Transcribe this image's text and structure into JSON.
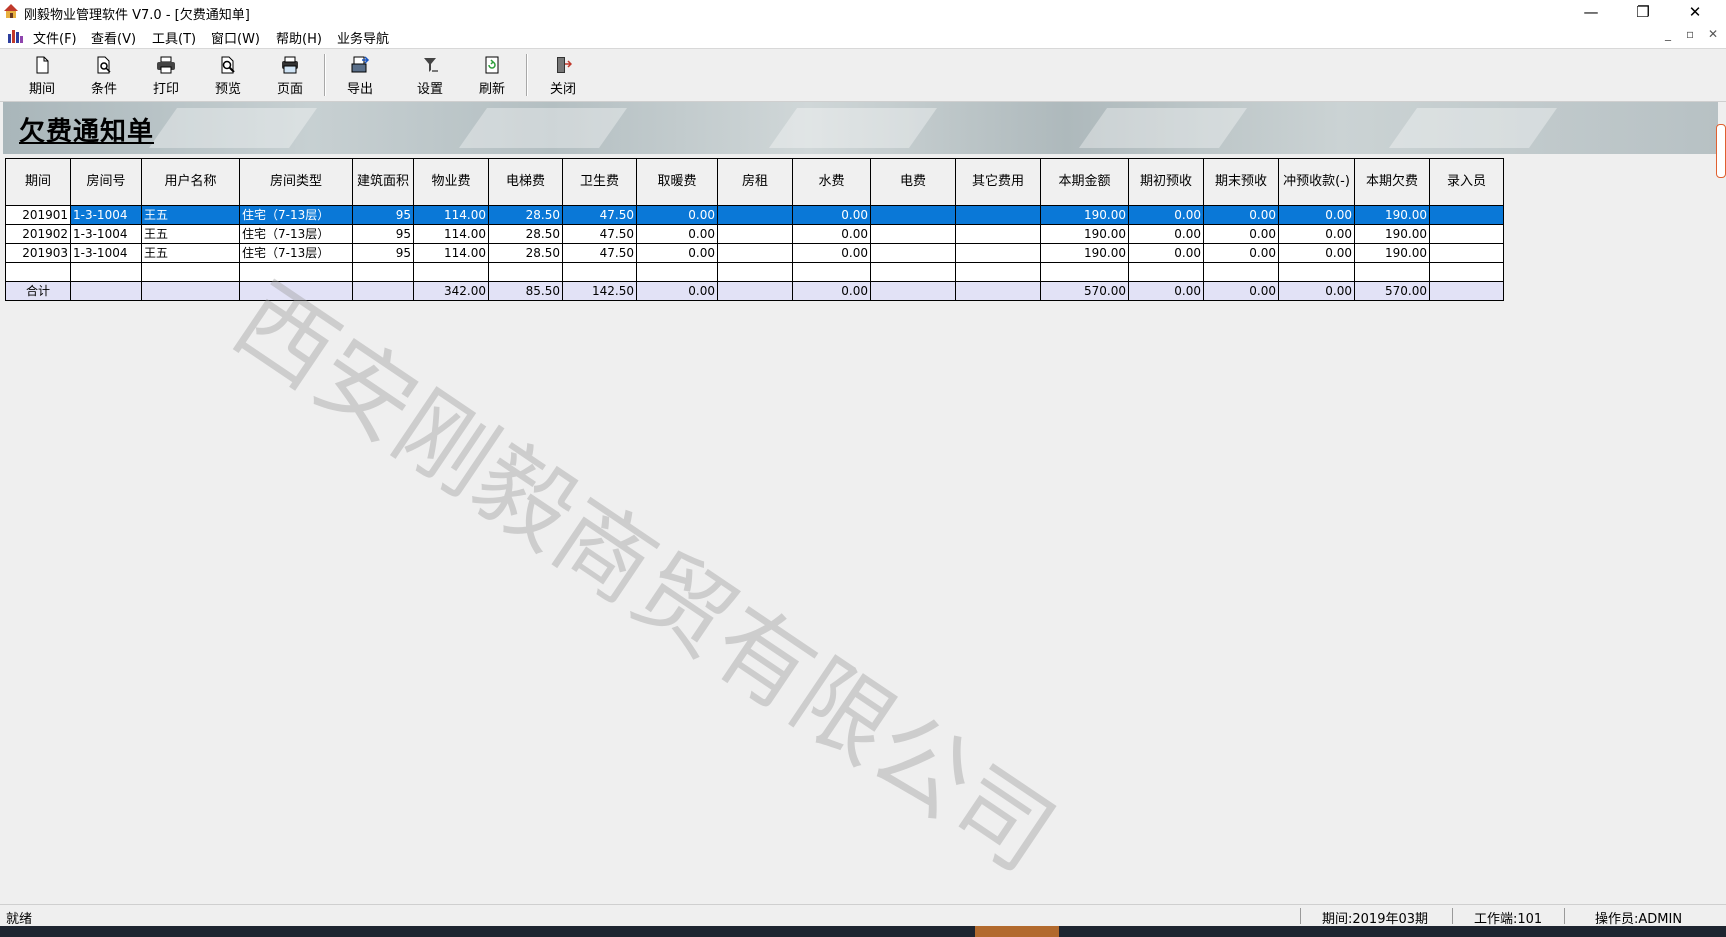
{
  "window": {
    "title": "刚毅物业管理软件 V7.0 - [欠费通知单]",
    "minimize": "—",
    "maximize": "❐",
    "close": "✕"
  },
  "menu": [
    {
      "label": "文件(F)"
    },
    {
      "label": "查看(V)"
    },
    {
      "label": "工具(T)"
    },
    {
      "label": "窗口(W)"
    },
    {
      "label": "帮助(H)"
    },
    {
      "label": "业务导航"
    }
  ],
  "mdi_controls": {
    "minimize": "_",
    "restore": "▫",
    "close": "✕"
  },
  "toolbar": [
    {
      "label": "期间",
      "icon": "page-icon"
    },
    {
      "label": "条件",
      "icon": "filter-doc-icon"
    },
    {
      "label": "打印",
      "icon": "printer-icon"
    },
    {
      "label": "预览",
      "icon": "preview-icon"
    },
    {
      "label": "页面",
      "icon": "page-setup-icon"
    },
    {
      "label": "导出",
      "icon": "export-icon"
    },
    {
      "label": "设置",
      "icon": "settings-icon"
    },
    {
      "label": "刷新",
      "icon": "refresh-icon"
    },
    {
      "label": "关闭",
      "icon": "exit-door-icon"
    }
  ],
  "banner": {
    "title": "欠费通知单"
  },
  "table": {
    "headers": [
      "期间",
      "房间号",
      "用户名称",
      "房间类型",
      "建筑面积",
      "物业费",
      "电梯费",
      "卫生费",
      "取暖费",
      "房租",
      "水费",
      "电费",
      "其它费用",
      "本期金额",
      "期初预收",
      "期末预收",
      "冲预收款(-)",
      "本期欠费",
      "录入员"
    ],
    "rows": [
      [
        "201901",
        "1-3-1004",
        "王五",
        "住宅（7-13层）",
        "95",
        "114.00",
        "28.50",
        "47.50",
        "0.00",
        "",
        "0.00",
        "",
        "",
        "190.00",
        "0.00",
        "0.00",
        "0.00",
        "190.00",
        ""
      ],
      [
        "201902",
        "1-3-1004",
        "王五",
        "住宅（7-13层）",
        "95",
        "114.00",
        "28.50",
        "47.50",
        "0.00",
        "",
        "0.00",
        "",
        "",
        "190.00",
        "0.00",
        "0.00",
        "0.00",
        "190.00",
        ""
      ],
      [
        "201903",
        "1-3-1004",
        "王五",
        "住宅（7-13层）",
        "95",
        "114.00",
        "28.50",
        "47.50",
        "0.00",
        "",
        "0.00",
        "",
        "",
        "190.00",
        "0.00",
        "0.00",
        "0.00",
        "190.00",
        ""
      ],
      [
        "",
        "",
        "",
        "",
        "",
        "",
        "",
        "",
        "",
        "",
        "",
        "",
        "",
        "",
        "",
        "",
        "",
        "",
        ""
      ]
    ],
    "total": [
      "合计",
      "",
      "",
      "",
      "",
      "342.00",
      "85.50",
      "142.50",
      "0.00",
      "",
      "0.00",
      "",
      "",
      "570.00",
      "0.00",
      "0.00",
      "0.00",
      "570.00",
      ""
    ],
    "selected_row": 0
  },
  "watermark": "西安刚毅商贸有限公司",
  "status": {
    "left": "就绪",
    "period": "期间:2019年03期",
    "workstation": "工作端:101",
    "operator": "操作员:ADMIN"
  },
  "colors": {
    "selection": "#0a78d7",
    "total_row": "#e2e2f6"
  }
}
